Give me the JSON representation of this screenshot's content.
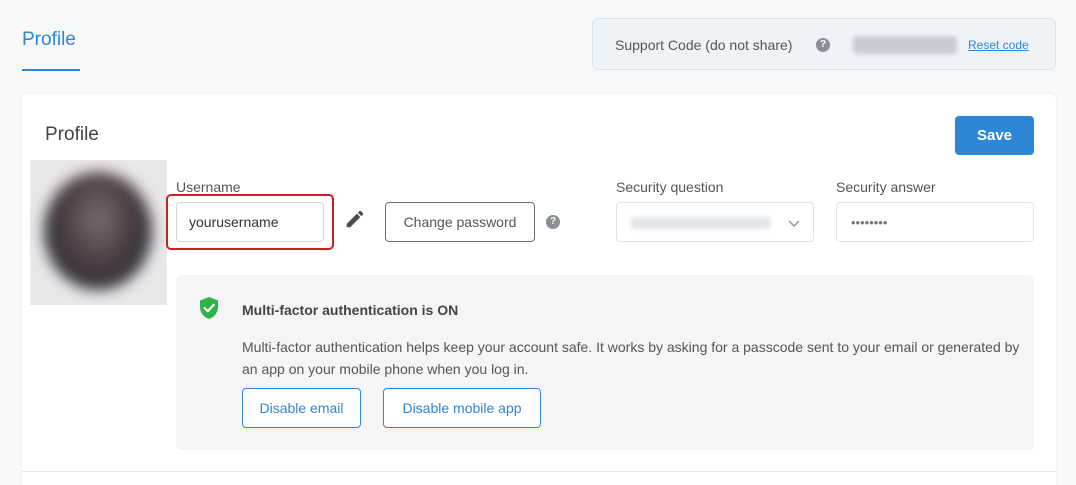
{
  "tabs": {
    "profile_label": "Profile"
  },
  "support": {
    "label": "Support Code (do not share)",
    "reset_label": "Reset code"
  },
  "card": {
    "title": "Profile",
    "save_label": "Save"
  },
  "fields": {
    "username_label": "Username",
    "username_value": "yourusername",
    "change_password_label": "Change password",
    "security_question_label": "Security question",
    "security_answer_label": "Security answer",
    "security_answer_value": "••••••••"
  },
  "mfa": {
    "title": "Multi-factor authentication is ON",
    "description": "Multi-factor authentication helps keep your account safe. It works by asking for a passcode sent to your email or generated by an app on your mobile phone when you log in.",
    "disable_email_label": "Disable email",
    "disable_mobile_label": "Disable mobile app"
  },
  "colors": {
    "accent": "#2f86d6",
    "highlight": "#cc1f1f",
    "shield": "#2db34a"
  },
  "icons": [
    "help-icon",
    "pencil-icon",
    "chevron-down-icon",
    "shield-check-icon"
  ]
}
